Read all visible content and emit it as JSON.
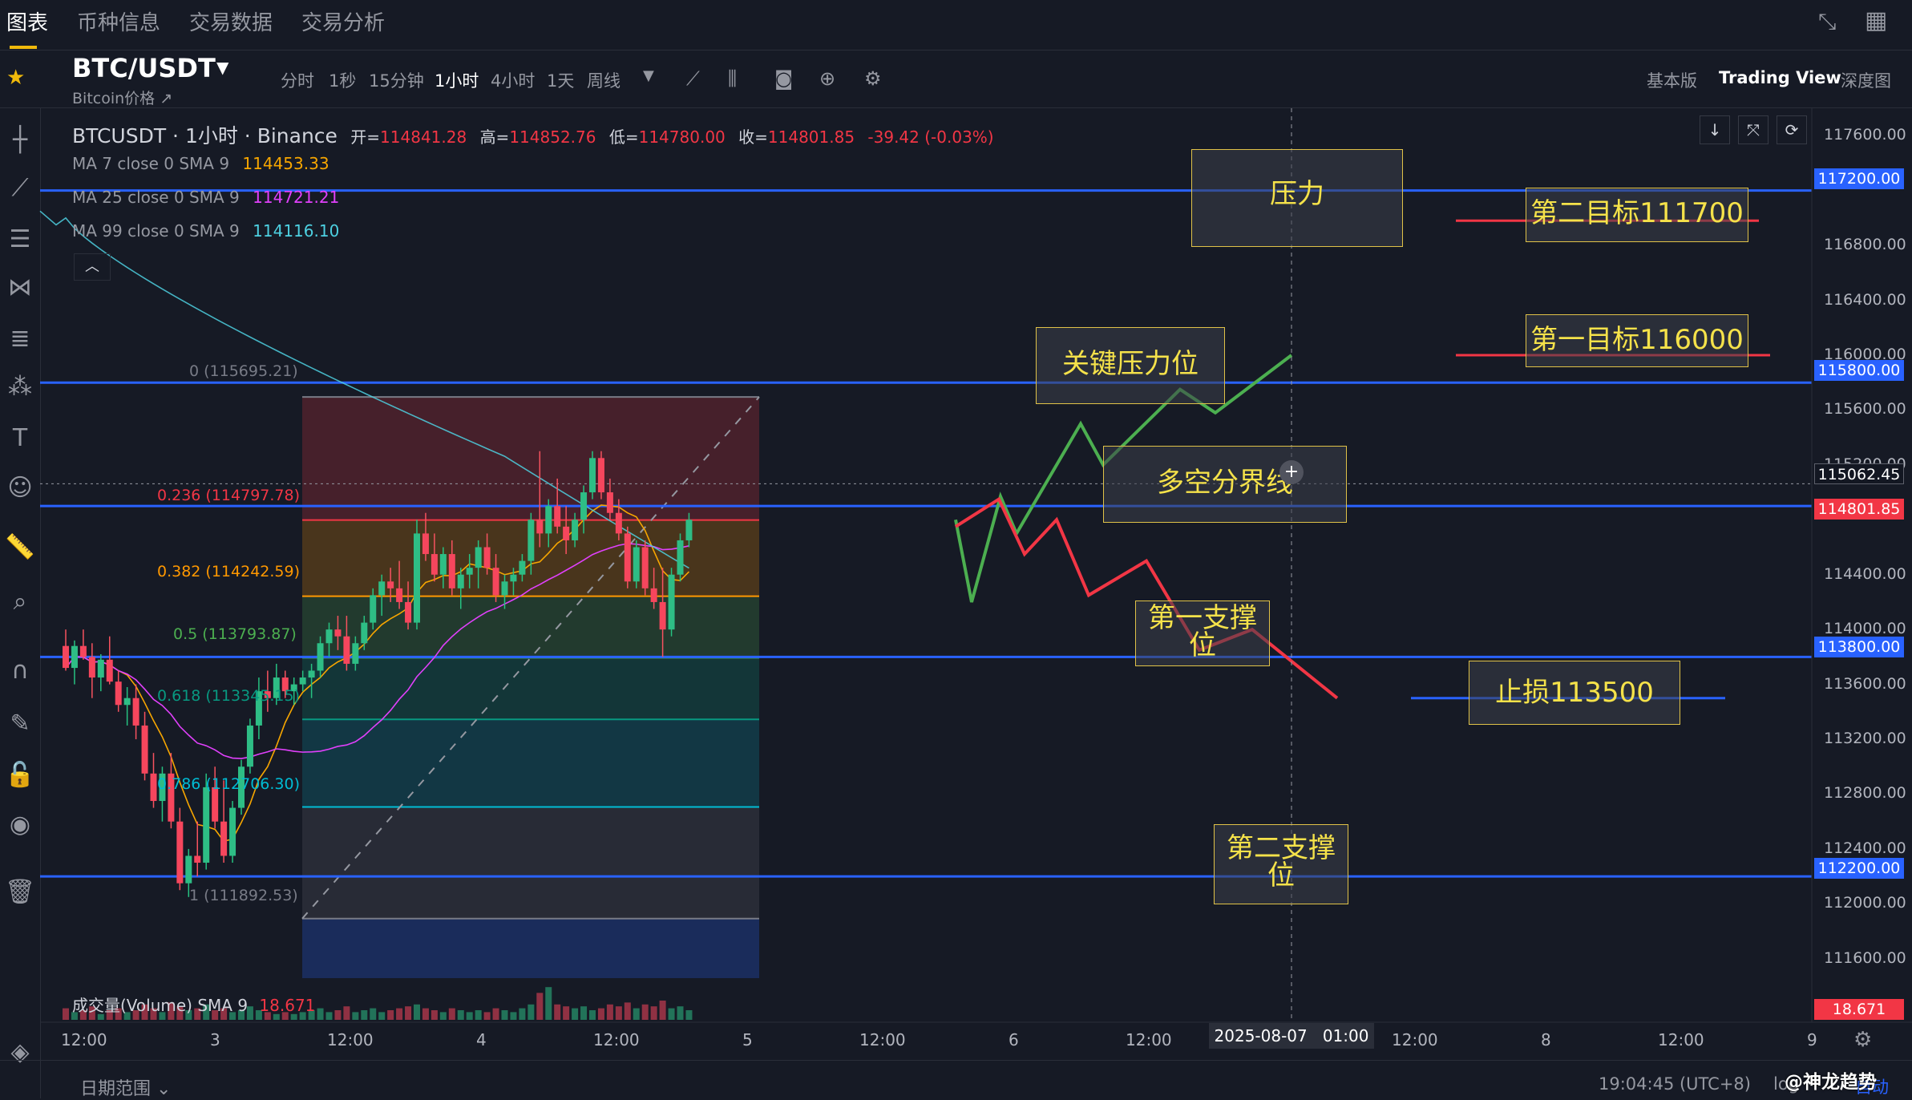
{
  "nav": {
    "tabs": [
      "图表",
      "币种信息",
      "交易数据",
      "交易分析"
    ],
    "active": "图表"
  },
  "symbol": {
    "name": "BTC/USDT",
    "subtitle": "Bitcoin价格 ↗"
  },
  "timeframes": [
    "分时",
    "1秒",
    "15分钟",
    "1小时",
    "4小时",
    "1天",
    "周线"
  ],
  "active_timeframe": "1小时",
  "view_modes": [
    "基本版",
    "Trading View",
    "深度图"
  ],
  "active_view": "Trading View",
  "ohlc": {
    "title": "BTCUSDT · 1小时 · Binance",
    "open_label": "开=",
    "open": "114841.28",
    "high_label": "高=",
    "high": "114852.76",
    "low_label": "低=",
    "low": "114780.00",
    "close_label": "收=",
    "close": "114801.85",
    "change": "-39.42 (-0.03%)"
  },
  "indicators": [
    {
      "label": "MA 7 close 0 SMA 9",
      "value": "114453.33",
      "color": "#f7a600"
    },
    {
      "label": "MA 25 close 0 SMA 9",
      "value": "114721.21",
      "color": "#e040fb"
    },
    {
      "label": "MA 99 close 0 SMA 9",
      "value": "114116.10",
      "color": "#4dd0e1"
    }
  ],
  "volume": {
    "label": "成交量(Volume) SMA 9",
    "value": "18.671"
  },
  "fib_levels": [
    {
      "label": "0 (115695.21)",
      "price": 115695.21,
      "color": "#787b86"
    },
    {
      "label": "0.236 (114797.78)",
      "price": 114797.78,
      "color": "#f23645"
    },
    {
      "label": "0.382 (114242.59)",
      "price": 114242.59,
      "color": "#ff9800"
    },
    {
      "label": "0.5 (113793.87)",
      "price": 113793.87,
      "color": "#4caf50"
    },
    {
      "label": "0.618 (113345.15)",
      "price": 113345.15,
      "color": "#089981"
    },
    {
      "label": "0.786 (112706.30)",
      "price": 112706.3,
      "color": "#00bcd4"
    },
    {
      "label": "1 (111892.53)",
      "price": 111892.53,
      "color": "#787b86"
    }
  ],
  "horizontal_lines": [
    117200,
    115800,
    115062.45,
    113800,
    112200
  ],
  "price_axis": {
    "ticks": [
      "117600.00",
      "116800.00",
      "116400.00",
      "116000.00",
      "115600.00",
      "115200.00",
      "114400.00",
      "114000.00",
      "113600.00",
      "113200.00",
      "112800.00",
      "112400.00",
      "112000.00",
      "111600.00"
    ],
    "labels": [
      {
        "text": "117200.00",
        "color": "#2962ff"
      },
      {
        "text": "115800.00",
        "color": "#2962ff"
      },
      {
        "text": "115062.45",
        "color": "#131722"
      },
      {
        "text": "114801.85",
        "color": "#f23645"
      },
      {
        "text": "113800.00",
        "color": "#2962ff"
      },
      {
        "text": "112200.00",
        "color": "#2962ff"
      },
      {
        "text": "18.671",
        "color": "#f23645"
      }
    ]
  },
  "time_axis": {
    "ticks": [
      "12:00",
      "3",
      "12:00",
      "4",
      "12:00",
      "5",
      "12:00",
      "6",
      "12:00",
      "12:00",
      "8",
      "12:00",
      "9"
    ],
    "crosshair_label": "2025-08-07   01:00"
  },
  "annotations": {
    "resistance": "压力",
    "target2": "第二目标111700",
    "target1": "第一目标116000",
    "key_resistance": "关键压力位",
    "bull_bear_line": "多空分界线",
    "support1": "第一支撑位",
    "stop_loss": "止损113500",
    "support2": "第二支撑位"
  },
  "footer": {
    "date_range": "日期范围 ⌄",
    "clock": "19:04:45 (UTC+8)",
    "watermark": "@神龙趋势",
    "scale_log": "log",
    "scale_auto": "自动"
  },
  "chart_data": {
    "type": "candlestick",
    "title": "BTCUSDT · 1小时 · Binance",
    "ylim": [
      111400,
      117800
    ],
    "price_bands": [
      117200,
      115800,
      113800,
      112200
    ],
    "projections": {
      "bullish_color": "#4caf50",
      "bearish_color": "#f23645"
    },
    "candles": [
      [
        113880,
        114000,
        113700,
        113720
      ],
      [
        113720,
        113920,
        113600,
        113880
      ],
      [
        113880,
        114000,
        113780,
        113800
      ],
      [
        113800,
        113900,
        113500,
        113650
      ],
      [
        113650,
        113820,
        113550,
        113780
      ],
      [
        113780,
        113950,
        113600,
        113620
      ],
      [
        113620,
        113700,
        113400,
        113450
      ],
      [
        113450,
        113580,
        113300,
        113500
      ],
      [
        113500,
        113600,
        113200,
        113300
      ],
      [
        113300,
        113400,
        112900,
        112950
      ],
      [
        112950,
        113100,
        112700,
        112750
      ],
      [
        112750,
        113000,
        112600,
        112950
      ],
      [
        112950,
        113100,
        112550,
        112600
      ],
      [
        112600,
        112700,
        112100,
        112150
      ],
      [
        112150,
        112400,
        112050,
        112350
      ],
      [
        112350,
        112600,
        112200,
        112300
      ],
      [
        112300,
        112950,
        112250,
        112850
      ],
      [
        112850,
        113000,
        112550,
        112600
      ],
      [
        112600,
        112900,
        112300,
        112350
      ],
      [
        112350,
        112750,
        112300,
        112700
      ],
      [
        112700,
        113050,
        112650,
        113000
      ],
      [
        113000,
        113350,
        112950,
        113300
      ],
      [
        113300,
        113650,
        113200,
        113550
      ],
      [
        113550,
        113700,
        113400,
        113500
      ],
      [
        113500,
        113750,
        113450,
        113650
      ],
      [
        113650,
        113700,
        113500,
        113550
      ],
      [
        113550,
        113650,
        113450,
        113600
      ],
      [
        113600,
        113700,
        113550,
        113650
      ],
      [
        113650,
        113750,
        113500,
        113700
      ],
      [
        113700,
        113950,
        113650,
        113900
      ],
      [
        113900,
        114050,
        113800,
        114000
      ],
      [
        114000,
        114100,
        113850,
        113950
      ],
      [
        113950,
        114100,
        113700,
        113750
      ],
      [
        113750,
        113950,
        113700,
        113900
      ],
      [
        113900,
        114100,
        113850,
        114050
      ],
      [
        114050,
        114300,
        114000,
        114250
      ],
      [
        114250,
        114400,
        114100,
        114350
      ],
      [
        114350,
        114450,
        114200,
        114300
      ],
      [
        114300,
        114500,
        114150,
        114200
      ],
      [
        114200,
        114350,
        114000,
        114050
      ],
      [
        114050,
        114800,
        114000,
        114700
      ],
      [
        114700,
        114850,
        114500,
        114550
      ],
      [
        114550,
        114700,
        114350,
        114400
      ],
      [
        114400,
        114600,
        114300,
        114550
      ],
      [
        114550,
        114650,
        114250,
        114300
      ],
      [
        114300,
        114450,
        114150,
        114400
      ],
      [
        114400,
        114550,
        114300,
        114450
      ],
      [
        114450,
        114650,
        114300,
        114600
      ],
      [
        114600,
        114700,
        114400,
        114450
      ],
      [
        114450,
        114550,
        114200,
        114250
      ],
      [
        114250,
        114400,
        114150,
        114350
      ],
      [
        114350,
        114450,
        114250,
        114400
      ],
      [
        114400,
        114550,
        114350,
        114500
      ],
      [
        114500,
        114850,
        114400,
        114800
      ],
      [
        114800,
        115300,
        114600,
        114700
      ],
      [
        114700,
        114950,
        114600,
        114900
      ],
      [
        114900,
        115100,
        114700,
        114750
      ],
      [
        114750,
        114900,
        114550,
        114650
      ],
      [
        114650,
        114850,
        114600,
        114800
      ],
      [
        114800,
        115050,
        114700,
        115000
      ],
      [
        115000,
        115300,
        114950,
        115250
      ],
      [
        115250,
        115300,
        114950,
        115000
      ],
      [
        115000,
        115100,
        114800,
        114850
      ],
      [
        114850,
        114950,
        114650,
        114700
      ],
      [
        114700,
        114750,
        114300,
        114350
      ],
      [
        114350,
        114650,
        114300,
        114600
      ],
      [
        114600,
        114650,
        114250,
        114300
      ],
      [
        114300,
        114450,
        114150,
        114200
      ],
      [
        114200,
        114450,
        113800,
        114000
      ],
      [
        114000,
        114450,
        113950,
        114400
      ],
      [
        114400,
        114700,
        114350,
        114650
      ],
      [
        114650,
        114850,
        114600,
        114800
      ]
    ],
    "volumes": [
      6,
      4,
      5,
      7,
      3,
      5,
      6,
      4,
      5,
      8,
      6,
      4,
      9,
      7,
      5,
      6,
      8,
      5,
      6,
      4,
      5,
      7,
      5,
      4,
      3,
      4,
      3,
      4,
      5,
      6,
      4,
      5,
      7,
      4,
      5,
      6,
      4,
      5,
      6,
      7,
      8,
      6,
      5,
      4,
      6,
      5,
      4,
      5,
      4,
      6,
      5,
      4,
      6,
      8,
      14,
      17,
      8,
      7,
      6,
      7,
      5,
      6,
      8,
      7,
      9,
      6,
      8,
      7,
      10,
      6,
      7,
      5
    ]
  }
}
